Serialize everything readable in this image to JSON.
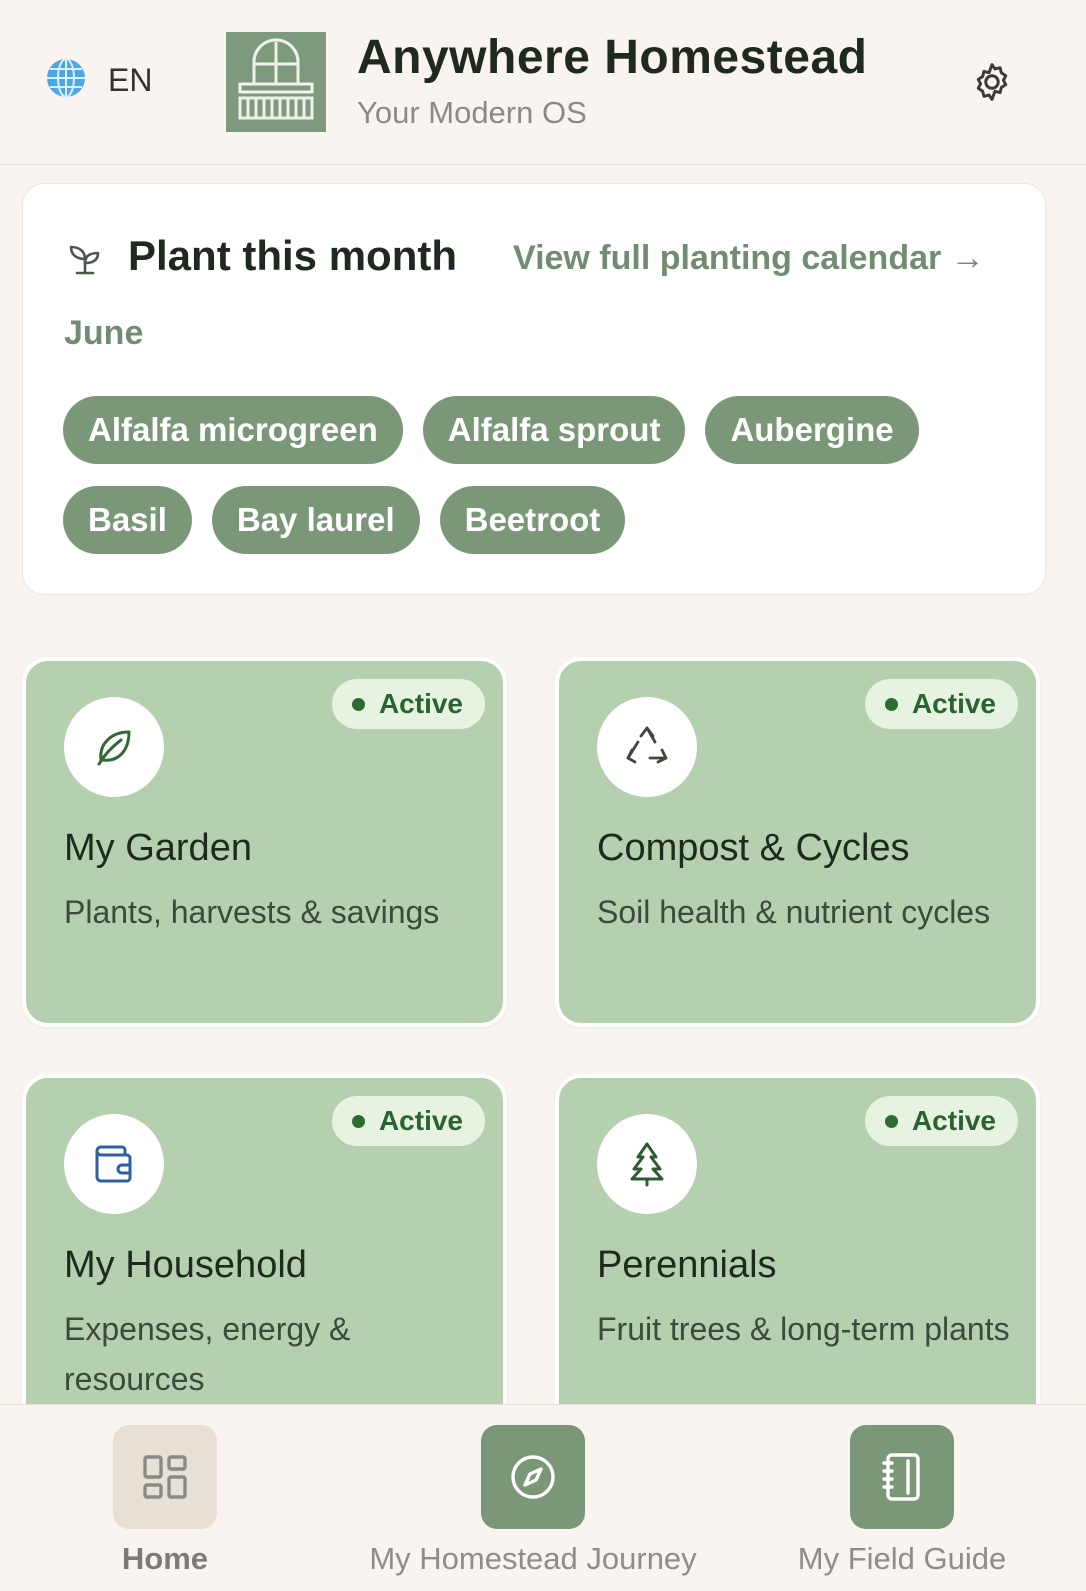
{
  "header": {
    "language": "EN",
    "app_title": "Anywhere Homestead",
    "app_subtitle": "Your Modern OS",
    "icons": {
      "language": "globe-icon",
      "logo": "homestead-logo",
      "settings": "gear-icon"
    }
  },
  "plant_card": {
    "title": "Plant this month",
    "calendar_link": "View full planting calendar →",
    "month": "June",
    "icon": "sprout-icon",
    "plants": [
      "Alfalfa microgreen",
      "Alfalfa sprout",
      "Aubergine",
      "Basil",
      "Bay laurel",
      "Beetroot"
    ]
  },
  "modules": [
    {
      "title": "My Garden",
      "description": "Plants, harvests & savings",
      "status": "Active",
      "icon": "leaf-icon"
    },
    {
      "title": "Compost & Cycles",
      "description": "Soil health & nutrient cycles",
      "status": "Active",
      "icon": "recycle-icon"
    },
    {
      "title": "My Household",
      "description": "Expenses, energy & resources",
      "status": "Active",
      "icon": "wallet-icon"
    },
    {
      "title": "Perennials",
      "description": "Fruit trees & long-term plants",
      "status": "Active",
      "icon": "tree-icon"
    }
  ],
  "bottom_nav": [
    {
      "label": "Home",
      "icon": "grid-icon",
      "active": true
    },
    {
      "label": "My Homestead Journey",
      "icon": "compass-icon",
      "active": false
    },
    {
      "label": "My Field Guide",
      "icon": "notebook-icon",
      "active": false
    }
  ],
  "colors": {
    "background": "#f9f4ef",
    "card_green": "#b5d0ae",
    "chip_green": "#7a9878",
    "accent_text": "#728c72",
    "badge_bg": "#e6f3e1",
    "badge_text": "#2b6330"
  }
}
